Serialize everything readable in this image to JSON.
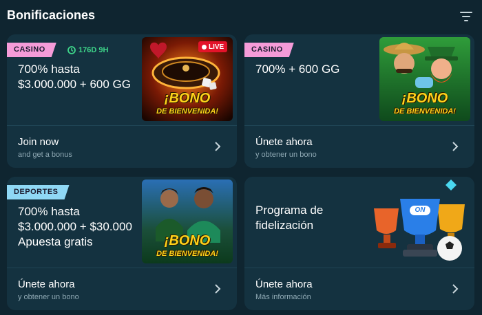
{
  "header": {
    "title": "Bonificaciones",
    "filter_icon": "filter-icon"
  },
  "cards": [
    {
      "tag": "CASINO",
      "tag_color": "#f59bd8",
      "timer": "176D 9H",
      "title": "700% hasta\n$3.000.000 + 600 GG",
      "image": {
        "icon": "roulette-live-image",
        "live_badge": "LIVE",
        "line1": "¡BONO",
        "line2": "DE BIENVENIDA!"
      },
      "cta": "Join now",
      "sub": "and get a bonus"
    },
    {
      "tag": "CASINO",
      "tag_color": "#f59bd8",
      "title": "700% + 600 GG",
      "image": {
        "icon": "leprechaun-characters-image",
        "line1": "¡BONO",
        "line2": "DE BIENVENIDA!"
      },
      "cta": "Únete ahora",
      "sub": "y obtener un bono"
    },
    {
      "tag": "DEPORTES",
      "tag_color": "#8fd8f5",
      "title": "700% hasta\n$3.000.000 + $30.000\nApuesta gratis",
      "image": {
        "icon": "athletes-image",
        "line1": "¡BONO",
        "line2": "DE BIENVENIDA!"
      },
      "cta": "Únete ahora",
      "sub": "y obtener un bono"
    },
    {
      "title": "Programa de\nfidelización",
      "image": {
        "icon": "trophies-image",
        "logo": "ON"
      },
      "cta": "Únete ahora",
      "sub": "Más información"
    }
  ],
  "colors": {
    "background": "#0f2530",
    "card": "#143240",
    "timer": "#3ed68a",
    "bono_text": "#ffd21a"
  }
}
